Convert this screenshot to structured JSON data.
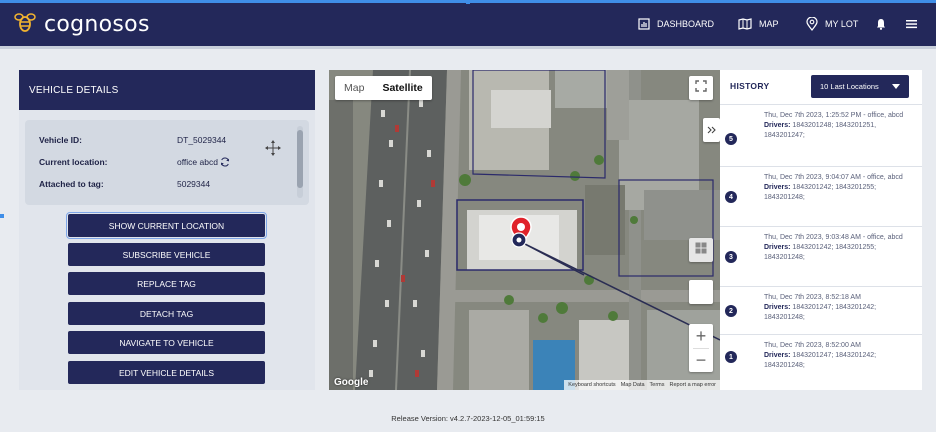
{
  "app": {
    "name": "cognosos"
  },
  "nav": {
    "dashboard": "DASHBOARD",
    "map": "MAP",
    "my_lot": "MY LOT"
  },
  "vehicle": {
    "panel_title": "VEHICLE DETAILS",
    "fields": [
      {
        "label": "Vehicle ID:",
        "value": "DT_5029344"
      },
      {
        "label": "Current location:",
        "value": "office abcd"
      },
      {
        "label": "Attached to tag:",
        "value": "5029344"
      }
    ],
    "buttons": [
      "SHOW CURRENT LOCATION",
      "SUBSCRIBE VEHICLE",
      "REPLACE TAG",
      "DETACH TAG",
      "NAVIGATE TO VEHICLE",
      "EDIT VEHICLE DETAILS"
    ]
  },
  "map": {
    "map_label": "Map",
    "satellite_label": "Satellite",
    "selected": "Satellite",
    "zoom_in": "+",
    "zoom_out": "−",
    "brand": "Google",
    "attribution": [
      "Keyboard shortcuts",
      "Map Data",
      "Terms",
      "Report a map error"
    ]
  },
  "history": {
    "title": "HISTORY",
    "dropdown": "10 Last Locations",
    "items": [
      {
        "num": "5",
        "time": "Thu, Dec 7th 2023, 1:25:52 PM - office, abcd",
        "drivers_label": "Drivers:",
        "drivers": "1843201248; 1843201251, 1843201247;"
      },
      {
        "num": "4",
        "time": "Thu, Dec 7th 2023, 9:04:07 AM - office, abcd",
        "drivers_label": "Drivers:",
        "drivers": "1843201242; 1843201255; 1843201248;"
      },
      {
        "num": "3",
        "time": "Thu, Dec 7th 2023, 9:03:48 AM - office, abcd",
        "drivers_label": "Drivers:",
        "drivers": "1843201242; 1843201255; 1843201248;"
      },
      {
        "num": "2",
        "time": "Thu, Dec 7th 2023, 8:52:18 AM",
        "drivers_label": "Drivers:",
        "drivers": "1843201247; 1843201242; 1843201248;"
      },
      {
        "num": "1",
        "time": "Thu, Dec 7th 2023, 8:52:00 AM",
        "drivers_label": "Drivers:",
        "drivers": "1843201247; 1843201242; 1843201248;"
      }
    ]
  },
  "footer": {
    "release": "Release Version: v4.2.7-2023-12-05_01:59:15"
  },
  "colors": {
    "primary": "#23285a",
    "accent": "#3f8ee8",
    "marker": "#e0222a"
  },
  "icons": [
    "bee-logo-icon",
    "dashboard-icon",
    "map-icon",
    "location-pin-icon",
    "bell-icon",
    "hamburger-menu-icon",
    "refresh-icon",
    "move-icon",
    "fullscreen-icon",
    "expand-chevrons-icon",
    "layers-grid-icon"
  ]
}
